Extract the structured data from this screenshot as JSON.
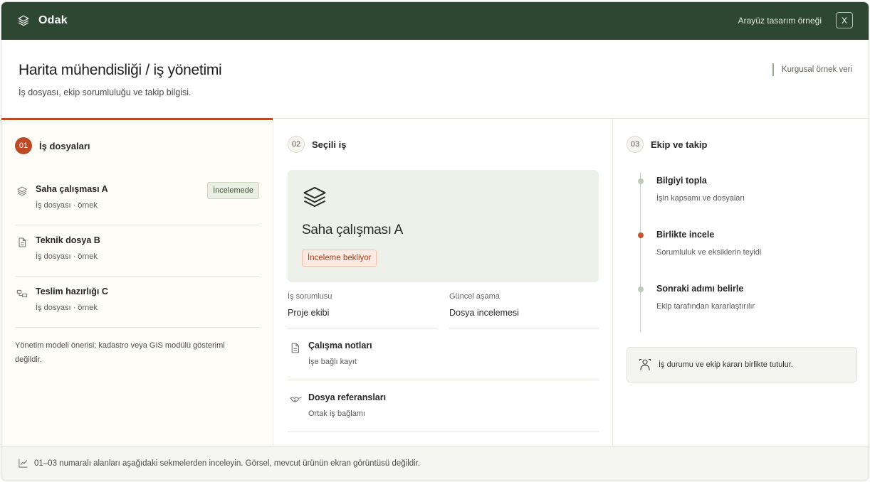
{
  "app": {
    "name": "Odak",
    "caption": "Arayüz tasarım örneği",
    "close_label": "X"
  },
  "header": {
    "title": "Harita mühendisliği / iş yönetimi",
    "subtitle": "İş dosyası, ekip sorumluluğu ve takip bilgisi.",
    "sample_tag": "Kurgusal örnek veri"
  },
  "panel1": {
    "number": "01",
    "title": "İş dosyaları",
    "items": [
      {
        "title": "Saha çalışması A",
        "subtitle": "İş dosyası · örnek",
        "badge": "İncelemede",
        "icon": "layers-icon"
      },
      {
        "title": "Teknik dosya B",
        "subtitle": "İş dosyası · örnek",
        "badge": "",
        "icon": "document-icon"
      },
      {
        "title": "Teslim hazırlığı C",
        "subtitle": "İş dosyası · örnek",
        "badge": "",
        "icon": "workflow-icon"
      }
    ],
    "note": "Yönetim modeli önerisi; kadastro veya GIS modülü gösterimi değildir."
  },
  "panel2": {
    "number": "02",
    "title": "Seçili iş",
    "card": {
      "title": "Saha çalışması A",
      "badge": "İnceleme bekliyor",
      "icon": "layers-icon"
    },
    "fields": [
      {
        "label": "İş sorumlusu",
        "value": "Proje ekibi"
      },
      {
        "label": "Güncel aşama",
        "value": "Dosya incelemesi"
      }
    ],
    "items": [
      {
        "title": "Çalışma notları",
        "subtitle": "İşe bağlı kayıt",
        "icon": "document-icon"
      },
      {
        "title": "Dosya referansları",
        "subtitle": "Ortak iş bağlamı",
        "icon": "handshake-icon"
      }
    ]
  },
  "panel3": {
    "number": "03",
    "title": "Ekip ve takip",
    "steps": [
      {
        "title": "Bilgiyi topla",
        "subtitle": "İşin kapsamı ve dosyaları",
        "state": "done"
      },
      {
        "title": "Birlikte incele",
        "subtitle": "Sorumluluk ve eksiklerin teyidi",
        "state": "current"
      },
      {
        "title": "Sonraki adımı belirle",
        "subtitle": "Ekip tarafından kararlaştırılır",
        "state": "pending"
      }
    ],
    "info": "İş durumu ve ekip kararı birlikte tutulur."
  },
  "footer": {
    "text": "01–03 numaralı alanları aşağıdaki sekmelerden inceleyin. Görsel, mevcut ürünün ekran görüntüsü değildir."
  },
  "colors": {
    "topbar": "#2e4733",
    "accent": "#bc4a26",
    "review_badge_bg": "#eaefe4",
    "wait_badge_bg": "#fbebe3"
  }
}
